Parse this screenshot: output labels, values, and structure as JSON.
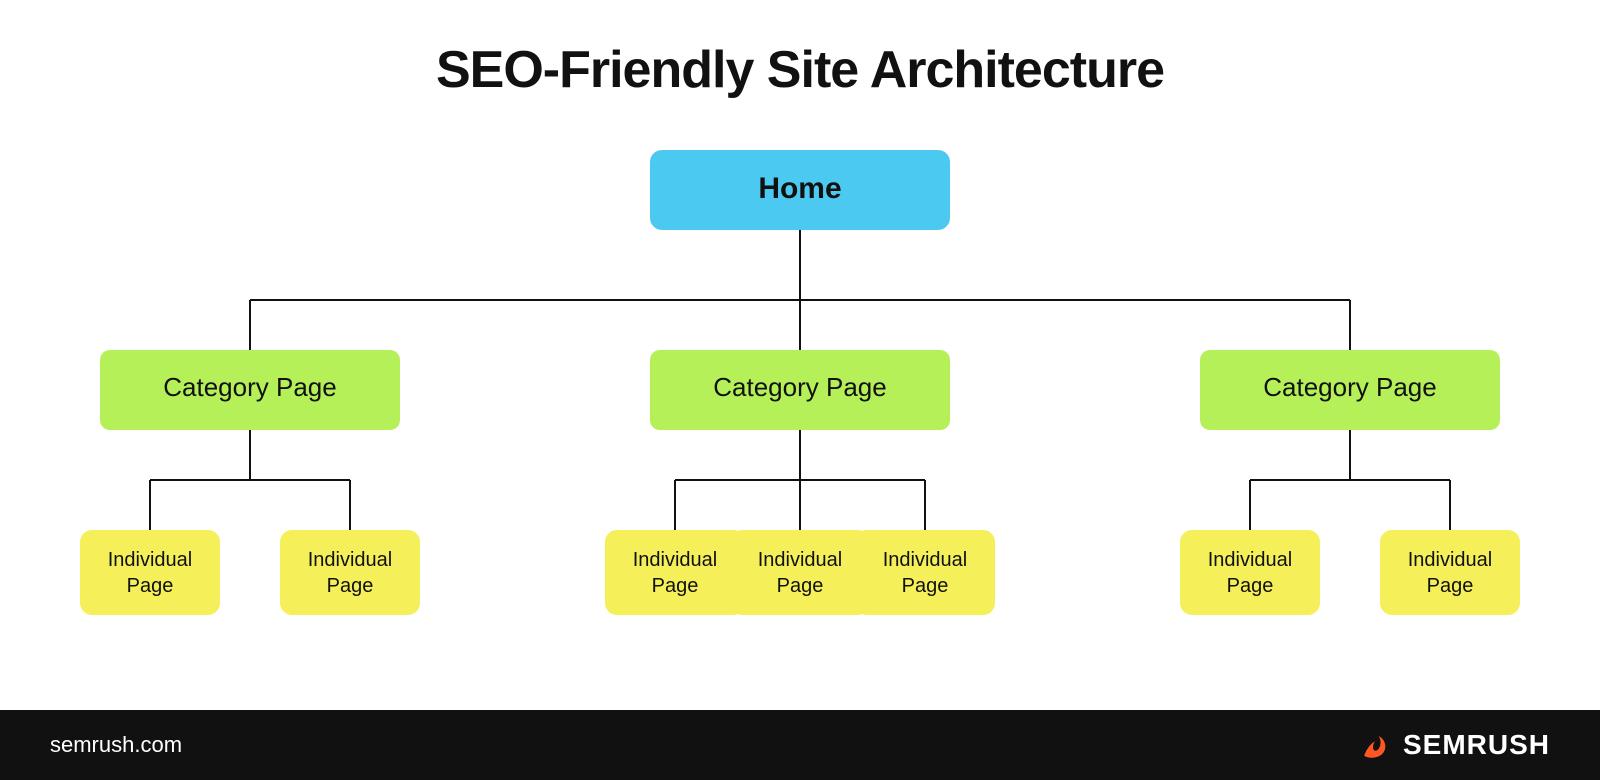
{
  "title": "SEO-Friendly Site Architecture",
  "home": {
    "label": "Home",
    "color": "#4cc9f0"
  },
  "categories": [
    {
      "label": "Category Page",
      "color": "#b5f059"
    },
    {
      "label": "Category Page",
      "color": "#b5f059"
    },
    {
      "label": "Category Page",
      "color": "#b5f059"
    }
  ],
  "individualPages": {
    "label": "Individual Page",
    "color": "#f5f059",
    "counts": [
      2,
      3,
      2
    ]
  },
  "footer": {
    "domain": "semrush.com",
    "brand": "SEMRUSH",
    "bgColor": "#111111"
  }
}
